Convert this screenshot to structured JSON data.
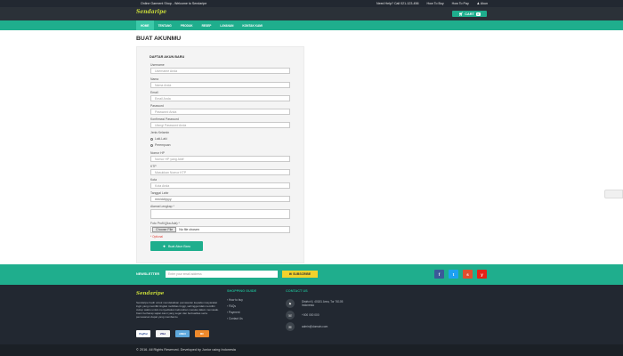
{
  "topbar": {
    "welcome": "Online Garment Shop - Welcome to Sendaripe",
    "help": "Need Help? Call 021-123-456",
    "how_to_buy": "How To Buy",
    "how_to_pay": "How To Pay",
    "user": "Akun"
  },
  "header": {
    "logo": "Sendaripe",
    "cart_label": "CART",
    "cart_count": "0"
  },
  "nav": {
    "items": [
      {
        "label": "HOME"
      },
      {
        "label": "TENTANG"
      },
      {
        "label": "PRODUK"
      },
      {
        "label": "RESEP"
      },
      {
        "label": "LAYANAN"
      },
      {
        "label": "KONTAK KAMI"
      }
    ]
  },
  "page": {
    "title": "BUAT AKUNMU",
    "form_heading": "DAFTAR AKUN BARU",
    "fields": {
      "username": {
        "label": "Username",
        "placeholder": "Username Anda"
      },
      "name": {
        "label": "Nama",
        "placeholder": "Nama Anda"
      },
      "email": {
        "label": "Email",
        "placeholder": "Email Anda"
      },
      "password": {
        "label": "Password",
        "placeholder": "Password Anda"
      },
      "confirm_password": {
        "label": "Konfirmasi Password",
        "placeholder": "Ulangi Password Anda"
      },
      "gender": {
        "label": "Jenis Kelamin",
        "options": [
          "Laki-Laki",
          "Perempuan"
        ]
      },
      "phone": {
        "label": "Nomor HP",
        "placeholder": "Nomor HP yang Aktif"
      },
      "ktp": {
        "label": "KTP",
        "placeholder": "Masukkan Nomor KTP"
      },
      "city": {
        "label": "Kota",
        "placeholder": "Kota Anda"
      },
      "birthdate": {
        "label": "Tanggal Lahir",
        "value": "mm/dd/yyyy"
      },
      "address": {
        "label": "Alamat Lengkap *"
      },
      "photo": {
        "label": "Foto Profil (jika Ada) *",
        "button": "Choose File",
        "status": "No file chosen"
      }
    },
    "optional_note": "* Optional",
    "submit_label": "Buat Akun Baru"
  },
  "newsletter": {
    "label": "NEWSLETTER",
    "placeholder": "Enter your email address",
    "button": "SUBSCRIBE"
  },
  "social": [
    "f",
    "t",
    "s",
    "y"
  ],
  "footer": {
    "logo": "Sendaripe",
    "about": "Sendaripe hadir untuk mendekatkan pemasaran kepada masyarakat ingin yang memiliki tingkat mobilitas tinggi, sehingga tidak memiliki cukup waktu untuk menyediakan kebutuhan mereka dalam memasak. Kami berharap sajian kami yang segar dan berkualitas serta pemesanan dapat yang membantu.",
    "payment_methods": [
      "PayPal",
      "VISA",
      "AMEX",
      "MC"
    ],
    "shopping_heading": "SHOPPING GUIDE",
    "shopping_links": [
      "How to buy",
      "FAQs",
      "Payment",
      "Contact Us"
    ],
    "contact_heading": "CONTACT US",
    "address": "District 6, 40181 Area, Tor 76105 Indonesia",
    "phone": "+000 000 000",
    "email": "admin@domain.com"
  },
  "copyright": "© 2016. All Rights Reserved. Developed by Junior using Indonesia",
  "colors": {
    "accent": "#1fae8d",
    "dark": "#222831",
    "yellow": "#f2d22c"
  }
}
